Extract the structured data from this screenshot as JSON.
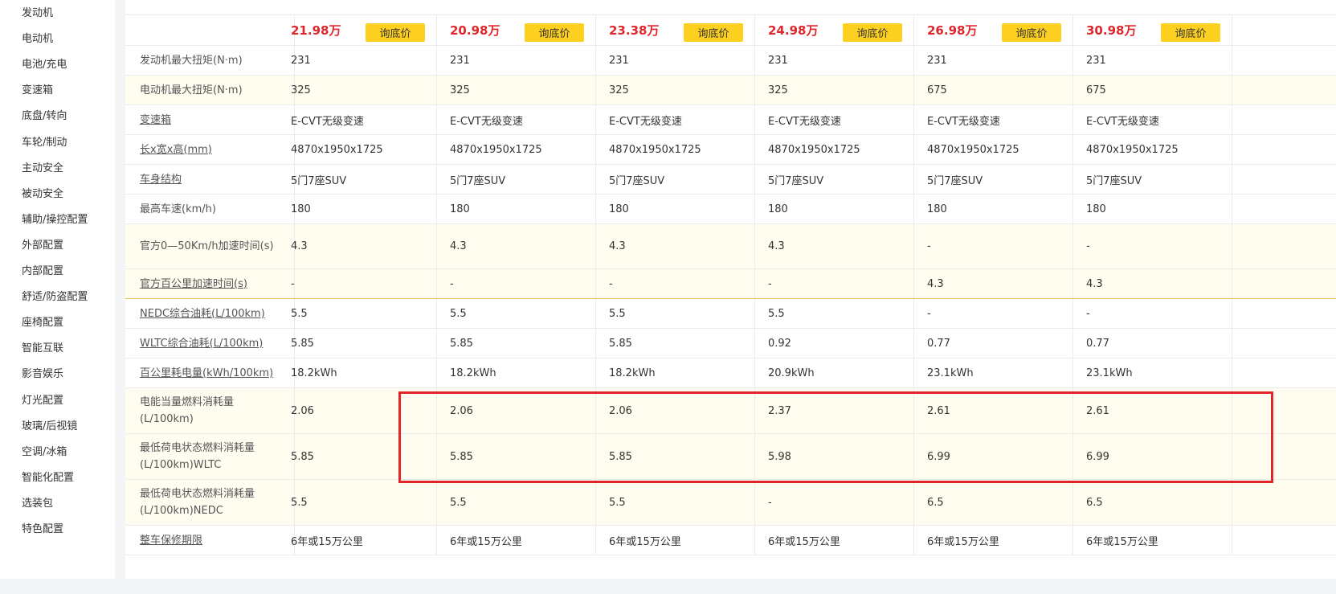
{
  "sidebar": {
    "items": [
      "发动机",
      "电动机",
      "电池/充电",
      "变速箱",
      "底盘/转向",
      "车轮/制动",
      "主动安全",
      "被动安全",
      "辅助/操控配置",
      "外部配置",
      "内部配置",
      "舒适/防盗配置",
      "座椅配置",
      "智能互联",
      "影音娱乐",
      "灯光配置",
      "玻璃/后视镜",
      "空调/冰箱",
      "智能化配置",
      "选装包",
      "特色配置"
    ]
  },
  "price_row": {
    "ask_label": "询底价",
    "prices": [
      "21.98万",
      "20.98万",
      "23.38万",
      "24.98万",
      "26.98万",
      "30.98万"
    ]
  },
  "rows": [
    {
      "label": "发动机最大扭矩(N·m)",
      "link": false,
      "values": [
        "231",
        "231",
        "231",
        "231",
        "231",
        "231"
      ]
    },
    {
      "label": "电动机最大扭矩(N·m)",
      "link": false,
      "values": [
        "325",
        "325",
        "325",
        "325",
        "675",
        "675"
      ]
    },
    {
      "label": "变速箱",
      "link": true,
      "values": [
        "E-CVT无级变速",
        "E-CVT无级变速",
        "E-CVT无级变速",
        "E-CVT无级变速",
        "E-CVT无级变速",
        "E-CVT无级变速"
      ]
    },
    {
      "label": "长x宽x高(mm)",
      "link": true,
      "values": [
        "4870x1950x1725",
        "4870x1950x1725",
        "4870x1950x1725",
        "4870x1950x1725",
        "4870x1950x1725",
        "4870x1950x1725"
      ]
    },
    {
      "label": "车身结构",
      "link": true,
      "values": [
        "5门7座SUV",
        "5门7座SUV",
        "5门7座SUV",
        "5门7座SUV",
        "5门7座SUV",
        "5门7座SUV"
      ]
    },
    {
      "label": "最高车速(km/h)",
      "link": false,
      "values": [
        "180",
        "180",
        "180",
        "180",
        "180",
        "180"
      ]
    },
    {
      "label": "官方0—50Km/h加速时间(s)",
      "link": false,
      "values": [
        "4.3",
        "4.3",
        "4.3",
        "4.3",
        "-",
        "-"
      ]
    },
    {
      "label": "官方百公里加速时间(s)",
      "link": true,
      "values": [
        "-",
        "-",
        "-",
        "-",
        "4.3",
        "4.3"
      ]
    },
    {
      "label": "NEDC综合油耗(L/100km)",
      "link": true,
      "values": [
        "5.5",
        "5.5",
        "5.5",
        "5.5",
        "-",
        "-"
      ]
    },
    {
      "label": "WLTC综合油耗(L/100km)",
      "link": true,
      "values": [
        "5.85",
        "5.85",
        "5.85",
        "0.92",
        "0.77",
        "0.77"
      ]
    },
    {
      "label": "百公里耗电量(kWh/100km)",
      "link": true,
      "values": [
        "18.2kWh",
        "18.2kWh",
        "18.2kWh",
        "20.9kWh",
        "23.1kWh",
        "23.1kWh"
      ]
    },
    {
      "label": "电能当量燃料消耗量(L/100km)",
      "link": false,
      "values": [
        "2.06",
        "2.06",
        "2.06",
        "2.37",
        "2.61",
        "2.61"
      ]
    },
    {
      "label": "最低荷电状态燃料消耗量(L/100km)WLTC",
      "link": false,
      "values": [
        "5.85",
        "5.85",
        "5.85",
        "5.98",
        "6.99",
        "6.99"
      ]
    },
    {
      "label": "最低荷电状态燃料消耗量(L/100km)NEDC",
      "link": false,
      "values": [
        "5.5",
        "5.5",
        "5.5",
        "-",
        "6.5",
        "6.5"
      ]
    },
    {
      "label": "整车保修期限",
      "link": true,
      "values": [
        "6年或15万公里",
        "6年或15万公里",
        "6年或15万公里",
        "6年或15万公里",
        "6年或15万公里",
        "6年或15万公里"
      ]
    }
  ],
  "colors": {
    "price": "#e0262c",
    "ask_button": "#fdd020",
    "highlight": "#e1262b",
    "alt_row": "#fffcf0"
  }
}
